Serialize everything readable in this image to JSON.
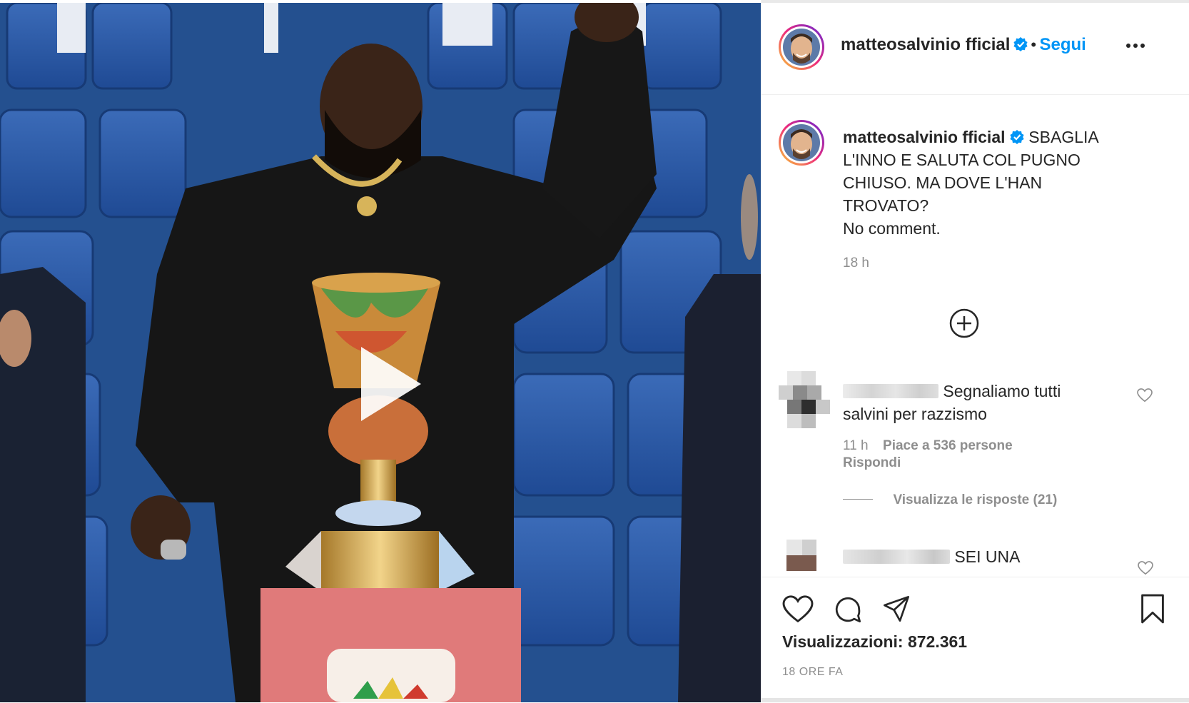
{
  "post": {
    "username": "matteosalvinio fficial",
    "follow_separator": "•",
    "follow_label": "Segui",
    "more_options": "…"
  },
  "caption": {
    "username": "matteosalvinio fficial",
    "text_line1": "SBAGLIA",
    "text_line2": "L'INNO E SALUTA COL PUGNO",
    "text_line3": "CHIUSO. MA DOVE L'HAN",
    "text_line4": "TROVATO?",
    "text_line5": "No comment.",
    "time": "18 h"
  },
  "load_more_icon": "plus-circle-icon",
  "comments": [
    {
      "text_line1": "Segnaliamo tutti",
      "text_line2": "salvini per razzismo",
      "time": "11 h",
      "likes": "Piace a 536 persone",
      "reply": "Rispondi",
      "view_replies": "Visualizza le risposte (21)"
    },
    {
      "text_line1": "SEI UNA"
    }
  ],
  "footer": {
    "views": "Visualizzazioni: 872.361",
    "time_ago": "18 ORE FA"
  },
  "icons": [
    "heart-icon",
    "comment-icon",
    "share-icon",
    "bookmark-icon",
    "play-icon",
    "verified-icon"
  ],
  "colors": {
    "accent": "#0095f6",
    "text": "#262626",
    "muted": "#8e8e8e"
  }
}
